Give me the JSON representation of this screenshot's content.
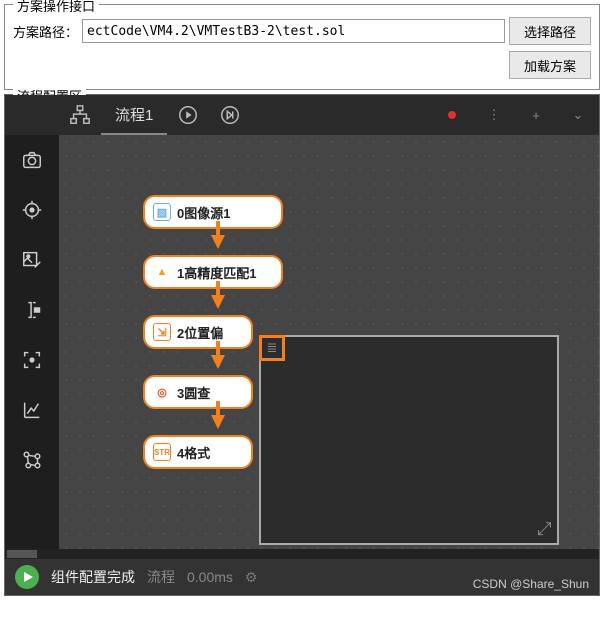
{
  "operation_panel": {
    "title": "方案操作接口",
    "path_label": "方案路径：",
    "path_value": "ectCode\\VM4.2\\VMTestB3-2\\test.sol",
    "select_path_btn": "选择路径",
    "load_btn": "加载方案"
  },
  "flow_panel": {
    "title": "流程配置区",
    "tab_name": "流程1",
    "nodes": [
      {
        "label": "0图像源1",
        "icon": "image-icon",
        "color": "#6bb0e0"
      },
      {
        "label": "1高精度匹配1",
        "icon": "triangle-icon",
        "color": "#f0a030"
      },
      {
        "label": "2位置偏",
        "icon": "position-icon",
        "color": "#f08020"
      },
      {
        "label": "3圆查",
        "icon": "circle-icon",
        "color": "#e05030"
      },
      {
        "label": "4格式",
        "icon": "str-icon",
        "color": "#f08020"
      }
    ],
    "status": {
      "text": "组件配置完成",
      "context": "流程",
      "time": "0.00ms"
    }
  },
  "watermark": "CSDN @Share_Shun"
}
